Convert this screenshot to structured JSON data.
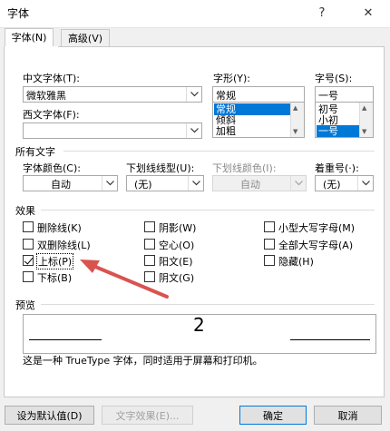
{
  "dialog": {
    "title": "字体",
    "help_label": "?",
    "close_label": "✕"
  },
  "tabs": [
    {
      "label": "字体(N)"
    },
    {
      "label": "高级(V)"
    }
  ],
  "fonts": {
    "chinese_font_label": "中文字体(T):",
    "chinese_font_value": "微软雅黑",
    "western_font_label": "西文字体(F):",
    "western_font_value": "",
    "style_label": "字形(Y):",
    "style_value": "常规",
    "style_options": [
      "常规",
      "倾斜",
      "加粗"
    ],
    "size_label": "字号(S):",
    "size_value": "一号",
    "size_options": [
      "初号",
      "小初",
      "一号"
    ]
  },
  "all_text": {
    "section_label": "所有文字",
    "font_color_label": "字体颜色(C):",
    "font_color_value": "自动",
    "underline_style_label": "下划线线型(U):",
    "underline_style_value": "(无)",
    "underline_color_label": "下划线颜色(I):",
    "underline_color_value": "自动",
    "emphasis_label": "着重号(·):",
    "emphasis_value": "(无)"
  },
  "effects": {
    "section_label": "效果",
    "items": [
      {
        "label": "删除线(K)",
        "checked": false
      },
      {
        "label": "双删除线(L)",
        "checked": false
      },
      {
        "label": "上标(P)",
        "checked": true
      },
      {
        "label": "下标(B)",
        "checked": false
      },
      {
        "label": "阴影(W)",
        "checked": false
      },
      {
        "label": "空心(O)",
        "checked": false
      },
      {
        "label": "阳文(E)",
        "checked": false
      },
      {
        "label": "阴文(G)",
        "checked": false
      },
      {
        "label": "小型大写字母(M)",
        "checked": false
      },
      {
        "label": "全部大写字母(A)",
        "checked": false
      },
      {
        "label": "隐藏(H)",
        "checked": false
      }
    ]
  },
  "preview": {
    "section_label": "预览",
    "sample_text": "2",
    "description": "这是一种 TrueType 字体，同时适用于屏幕和打印机。"
  },
  "buttons": {
    "set_default": "设为默认值(D)",
    "text_effects": "文字效果(E)...",
    "ok": "确定",
    "cancel": "取消"
  },
  "colors": {
    "selection": "#0078d7",
    "arrow": "#d9534f"
  }
}
